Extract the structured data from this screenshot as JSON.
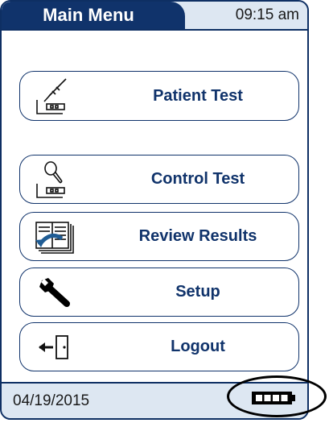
{
  "header": {
    "title": "Main Menu",
    "time": "09:15 am"
  },
  "menu": {
    "items": [
      {
        "label": "Patient Test",
        "icon": "syringe-test-strip-icon"
      },
      {
        "label": "Control Test",
        "icon": "dropper-test-strip-icon"
      },
      {
        "label": "Review Results",
        "icon": "book-results-icon"
      },
      {
        "label": "Setup",
        "icon": "wrench-icon"
      },
      {
        "label": "Logout",
        "icon": "logout-door-icon"
      }
    ]
  },
  "footer": {
    "date": "04/19/2015",
    "battery": {
      "level": 1.0
    }
  },
  "colors": {
    "primary": "#10336b",
    "bar": "#dde7f2"
  }
}
